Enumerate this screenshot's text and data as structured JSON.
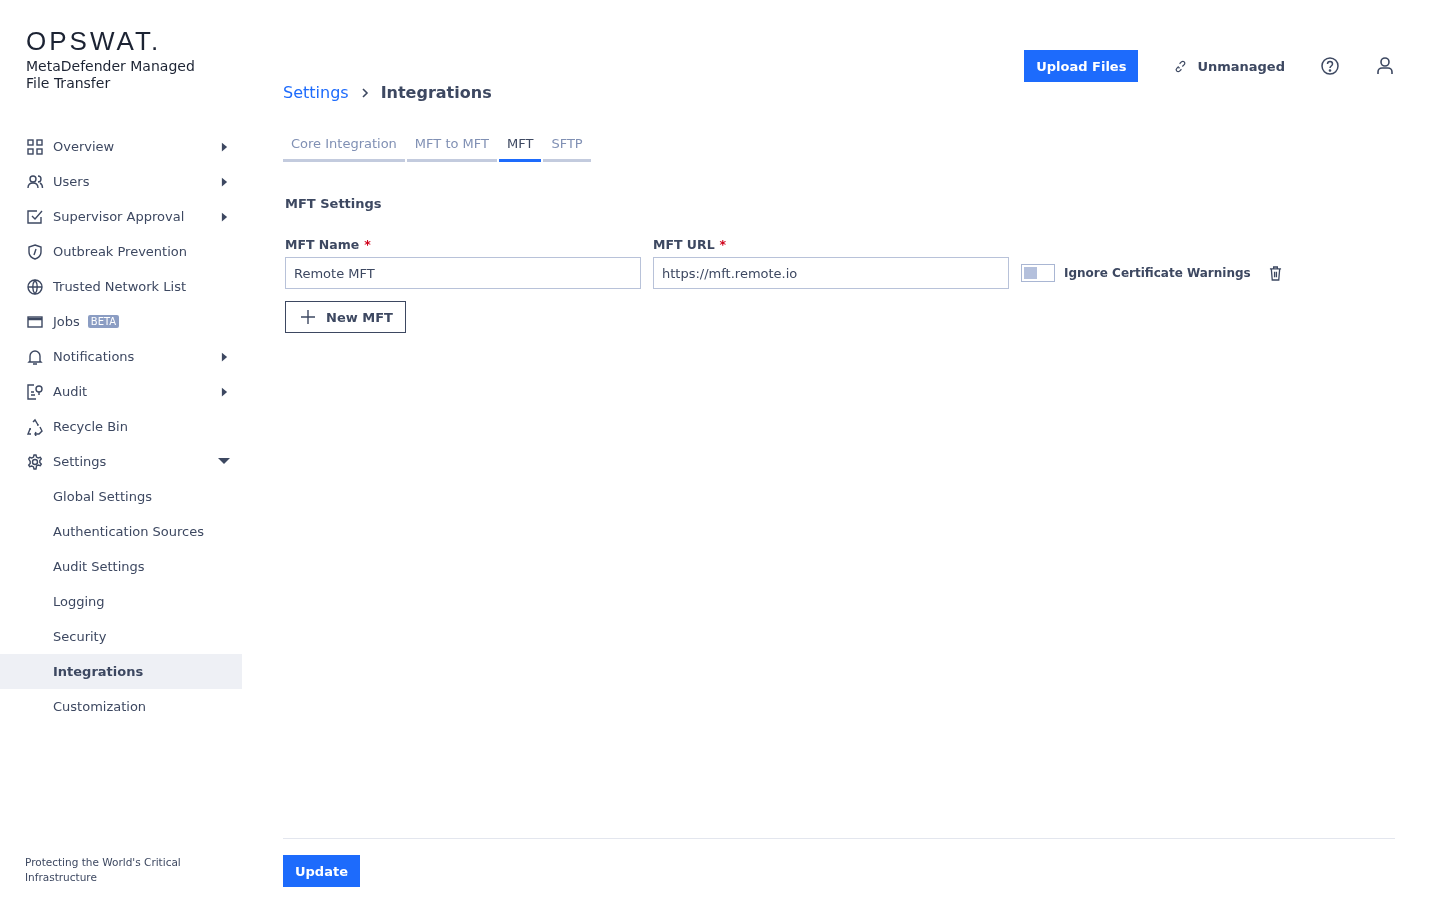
{
  "brand": {
    "logo": "OPSWAT.",
    "product": "MetaDefender Managed File Transfer",
    "tagline": "Protecting the World's Critical Infrastructure"
  },
  "header": {
    "upload_button": "Upload Files",
    "status": "Unmanaged"
  },
  "sidebar": {
    "items": [
      {
        "label": "Overview",
        "has_submenu": true,
        "expanded": false,
        "selected": false
      },
      {
        "label": "Users",
        "has_submenu": true,
        "expanded": false,
        "selected": false
      },
      {
        "label": "Supervisor Approval",
        "has_submenu": true,
        "expanded": false,
        "selected": false
      },
      {
        "label": "Outbreak Prevention",
        "selected": false
      },
      {
        "label": "Trusted Network List",
        "selected": false
      },
      {
        "label": "Jobs",
        "badge": "BETA",
        "selected": false
      },
      {
        "label": "Notifications",
        "has_submenu": true,
        "expanded": false,
        "selected": false
      },
      {
        "label": "Audit",
        "has_submenu": true,
        "expanded": false,
        "selected": false
      },
      {
        "label": "Recycle Bin",
        "selected": false
      },
      {
        "label": "Settings",
        "has_submenu": true,
        "expanded": true,
        "selected": false,
        "children": [
          {
            "label": "Global Settings",
            "selected": false
          },
          {
            "label": "Authentication Sources",
            "selected": false
          },
          {
            "label": "Audit Settings",
            "selected": false
          },
          {
            "label": "Logging",
            "selected": false
          },
          {
            "label": "Security",
            "selected": false
          },
          {
            "label": "Integrations",
            "selected": true
          },
          {
            "label": "Customization",
            "selected": false
          }
        ]
      }
    ]
  },
  "breadcrumb": [
    "Settings",
    "Integrations"
  ],
  "tabs": [
    {
      "label": "Core Integration",
      "selected": false
    },
    {
      "label": "MFT to MFT",
      "selected": false
    },
    {
      "label": "MFT",
      "selected": true
    },
    {
      "label": "SFTP",
      "selected": false
    }
  ],
  "section_title": "MFT Settings",
  "fields": [
    {
      "label": "MFT Name",
      "required_mark": "*",
      "value": "Remote MFT"
    },
    {
      "label": "MFT URL",
      "required_mark": "*",
      "value": "https://mft.remote.io"
    }
  ],
  "ignore_cert": {
    "label": "Ignore Certificate Warnings",
    "on": false
  },
  "new_button": "New MFT",
  "update_button": "Update"
}
